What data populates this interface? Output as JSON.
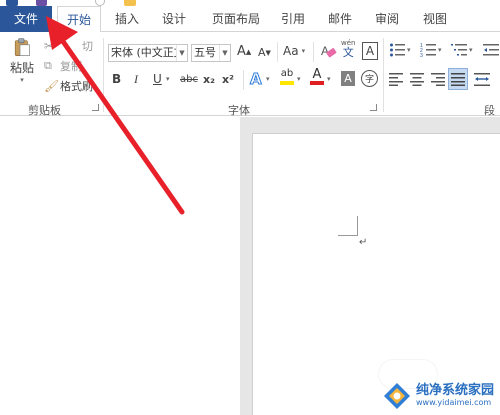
{
  "colors": {
    "file_tab": "#2b579a",
    "accent": "#2b579a",
    "arrow": "#e8202a",
    "font_color_red": "#e02020",
    "highlight_yellow": "#ffe600"
  },
  "tabs": [
    {
      "label": "文件"
    },
    {
      "label": "开始"
    },
    {
      "label": "插入"
    },
    {
      "label": "设计"
    },
    {
      "label": "页面布局"
    },
    {
      "label": "引用"
    },
    {
      "label": "邮件"
    },
    {
      "label": "审阅"
    },
    {
      "label": "视图"
    }
  ],
  "clipboard": {
    "paste_label": "粘贴",
    "cut_label": "切",
    "copy_label": "复制",
    "format_painter_label": "格式刷",
    "group_label": "剪贴板"
  },
  "font": {
    "font_name": "宋体 (中文正文)",
    "font_size": "五号",
    "group_label": "字体",
    "grow_icon": "A",
    "shrink_icon": "A",
    "case_label": "Aa",
    "phonetic_top": "wén",
    "phonetic_char": "文",
    "border_char": "A",
    "bold": "B",
    "italic": "I",
    "underline": "U",
    "strike": "abc",
    "subscript": "x₂",
    "superscript": "x²",
    "text_effect": "A",
    "highlight": "ab",
    "font_color": "A",
    "char_shading": "A",
    "enclose_char": "字"
  },
  "paragraph": {
    "group_label": "段落"
  },
  "document": {
    "paragraph_mark": "↵"
  },
  "watermark": {
    "title": "纯净系统家园",
    "url": "www.yidaimei.com"
  }
}
